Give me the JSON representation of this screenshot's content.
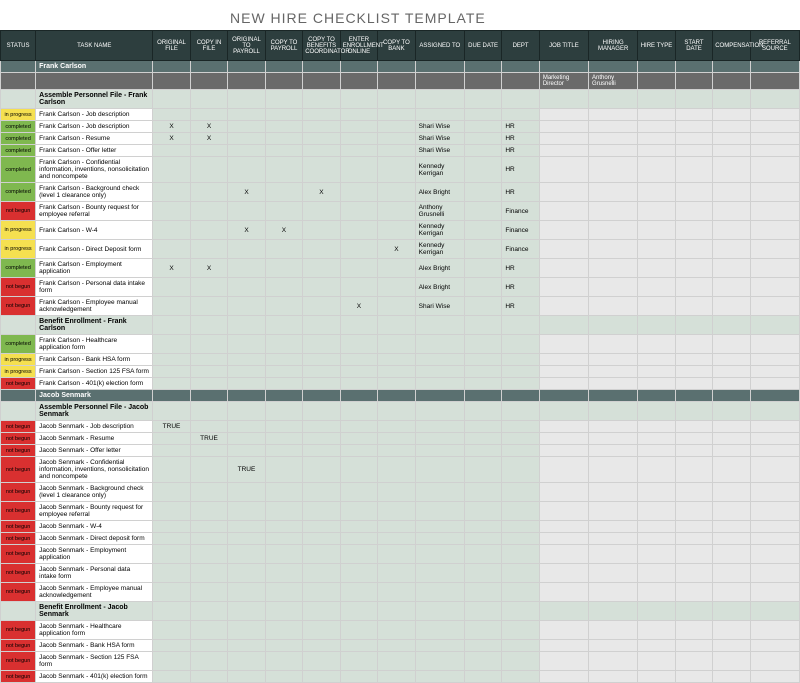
{
  "title": "NEW HIRE CHECKLIST TEMPLATE",
  "headers": [
    "STATUS",
    "TASK NAME",
    "ORIGINAL FILE",
    "COPY IN FILE",
    "ORIGINAL TO PAYROLL",
    "COPY TO PAYROLL",
    "COPY TO BENEFITS COORDINATOR",
    "ENTER ENROLLMENT ONLINE",
    "COPY TO BANK",
    "ASSIGNED TO",
    "DUE DATE",
    "DEPT",
    "JOB TITLE",
    "HIRING MANAGER",
    "HIRE TYPE",
    "START DATE",
    "COMPENSATION",
    "REFERRAL SOURCE"
  ],
  "statusLabels": {
    "completed": "completed",
    "progress": "in progress",
    "notbegun": "not begun"
  },
  "jobTitle": "Marketing Director",
  "hiringMgr": "Anthony Grusnelli",
  "employees": [
    {
      "name": "Frank Carlson",
      "sections": [
        {
          "title": "Assemble Personnel File - Frank Carlson",
          "rows": [
            {
              "status": "progress",
              "task": "Frank Carlson - Job description",
              "marks": [
                null,
                null,
                null,
                null,
                null,
                null,
                null
              ],
              "assigned": "",
              "dept": ""
            },
            {
              "status": "completed",
              "task": "Frank Carlson - Job description",
              "marks": [
                "X",
                "X",
                null,
                null,
                null,
                null,
                null
              ],
              "assigned": "Shari Wise",
              "dept": "HR"
            },
            {
              "status": "completed",
              "task": "Frank Carlson - Resume",
              "marks": [
                "X",
                "X",
                null,
                null,
                null,
                null,
                null
              ],
              "assigned": "Shari Wise",
              "dept": "HR"
            },
            {
              "status": "completed",
              "task": "Frank Carlson - Offer letter",
              "marks": [
                null,
                null,
                null,
                null,
                null,
                null,
                null
              ],
              "assigned": "Shari Wise",
              "dept": "HR"
            },
            {
              "status": "completed",
              "task": "Frank Carlson - Confidential information, inventions, nonsolicitation and noncompete",
              "marks": [
                null,
                null,
                null,
                null,
                null,
                null,
                null
              ],
              "assigned": "Kennedy Kerrigan",
              "dept": "HR"
            },
            {
              "status": "completed",
              "task": "Frank Carlson - Background check (level 1 clearance only)",
              "marks": [
                null,
                null,
                "X",
                null,
                "X",
                null,
                null
              ],
              "assigned": "Alex Bright",
              "dept": "HR"
            },
            {
              "status": "notbegun",
              "task": "Frank Carlson - Bounty request for employee referral",
              "marks": [
                null,
                null,
                null,
                null,
                null,
                null,
                null
              ],
              "assigned": "Anthony Grusnelli",
              "dept": "Finance"
            },
            {
              "status": "progress",
              "task": "Frank Carlson - W-4",
              "marks": [
                null,
                null,
                "X",
                "X",
                null,
                null,
                null
              ],
              "assigned": "Kennedy Kerrigan",
              "dept": "Finance"
            },
            {
              "status": "progress",
              "task": "Frank Carlson - Direct Deposit form",
              "marks": [
                null,
                null,
                null,
                null,
                null,
                null,
                "X"
              ],
              "assigned": "Kennedy Kerrigan",
              "dept": "Finance"
            },
            {
              "status": "completed",
              "task": "Frank Carlson - Employment application",
              "marks": [
                "X",
                "X",
                null,
                null,
                null,
                null,
                null
              ],
              "assigned": "Alex Bright",
              "dept": "HR"
            },
            {
              "status": "notbegun",
              "task": "Frank Carlson - Personal data intake form",
              "marks": [
                null,
                null,
                null,
                null,
                null,
                null,
                null
              ],
              "assigned": "Alex Bright",
              "dept": "HR"
            },
            {
              "status": "notbegun",
              "task": "Frank Carlson - Employee manual acknowledgement",
              "marks": [
                null,
                null,
                null,
                null,
                null,
                "X",
                null
              ],
              "assigned": "Shari Wise",
              "dept": "HR"
            }
          ]
        },
        {
          "title": "Benefit Enrollment - Frank Carlson",
          "rows": [
            {
              "status": "completed",
              "task": "Frank Carlson - Healthcare application form",
              "marks": [
                null,
                null,
                null,
                null,
                null,
                null,
                null
              ],
              "assigned": "",
              "dept": ""
            },
            {
              "status": "progress",
              "task": "Frank Carlson - Bank HSA form",
              "marks": [
                null,
                null,
                null,
                null,
                null,
                null,
                null
              ],
              "assigned": "",
              "dept": ""
            },
            {
              "status": "progress",
              "task": "Frank Carlson - Section 125 FSA form",
              "marks": [
                null,
                null,
                null,
                null,
                null,
                null,
                null
              ],
              "assigned": "",
              "dept": ""
            },
            {
              "status": "notbegun",
              "task": "Frank Carlson - 401(k) election form",
              "marks": [
                null,
                null,
                null,
                null,
                null,
                null,
                null
              ],
              "assigned": "",
              "dept": ""
            }
          ]
        }
      ]
    },
    {
      "name": "Jacob Senmark",
      "sections": [
        {
          "title": "Assemble Personnel File - Jacob Senmark",
          "rows": [
            {
              "status": "notbegun",
              "task": "Jacob Senmark - Job description",
              "marks": [
                "TRUE",
                null,
                null,
                null,
                null,
                null,
                null
              ],
              "assigned": "",
              "dept": ""
            },
            {
              "status": "notbegun",
              "task": "Jacob Senmark - Resume",
              "marks": [
                null,
                "TRUE",
                null,
                null,
                null,
                null,
                null
              ],
              "assigned": "",
              "dept": ""
            },
            {
              "status": "notbegun",
              "task": "Jacob Senmark - Offer letter",
              "marks": [
                null,
                null,
                null,
                null,
                null,
                null,
                null
              ],
              "assigned": "",
              "dept": ""
            },
            {
              "status": "notbegun",
              "task": "Jacob Senmark - Confidential information, inventions, nonsolicitation and noncompete",
              "marks": [
                null,
                null,
                "TRUE",
                null,
                null,
                null,
                null
              ],
              "assigned": "",
              "dept": ""
            },
            {
              "status": "notbegun",
              "task": "Jacob Senmark - Background check (level 1 clearance only)",
              "marks": [
                null,
                null,
                null,
                null,
                null,
                null,
                null
              ],
              "assigned": "",
              "dept": ""
            },
            {
              "status": "notbegun",
              "task": "Jacob Senmark - Bounty request for employee referral",
              "marks": [
                null,
                null,
                null,
                null,
                null,
                null,
                null
              ],
              "assigned": "",
              "dept": ""
            },
            {
              "status": "notbegun",
              "task": "Jacob Senmark - W-4",
              "marks": [
                null,
                null,
                null,
                null,
                null,
                null,
                null
              ],
              "assigned": "",
              "dept": ""
            },
            {
              "status": "notbegun",
              "task": "Jacob Senmark - Direct deposit form",
              "marks": [
                null,
                null,
                null,
                null,
                null,
                null,
                null
              ],
              "assigned": "",
              "dept": ""
            },
            {
              "status": "notbegun",
              "task": "Jacob Senmark - Employment application",
              "marks": [
                null,
                null,
                null,
                null,
                null,
                null,
                null
              ],
              "assigned": "",
              "dept": ""
            },
            {
              "status": "notbegun",
              "task": "Jacob Senmark - Personal data intake form",
              "marks": [
                null,
                null,
                null,
                null,
                null,
                null,
                null
              ],
              "assigned": "",
              "dept": ""
            },
            {
              "status": "notbegun",
              "task": "Jacob Senmark - Employee manual acknowledgement",
              "marks": [
                null,
                null,
                null,
                null,
                null,
                null,
                null
              ],
              "assigned": "",
              "dept": ""
            }
          ]
        },
        {
          "title": "Benefit Enrollment - Jacob Senmark",
          "rows": [
            {
              "status": "notbegun",
              "task": "Jacob Senmark - Healthcare application form",
              "marks": [
                null,
                null,
                null,
                null,
                null,
                null,
                null
              ],
              "assigned": "",
              "dept": ""
            },
            {
              "status": "notbegun",
              "task": "Jacob Senmark - Bank HSA form",
              "marks": [
                null,
                null,
                null,
                null,
                null,
                null,
                null
              ],
              "assigned": "",
              "dept": ""
            },
            {
              "status": "notbegun",
              "task": "Jacob Senmark - Section 125 FSA form",
              "marks": [
                null,
                null,
                null,
                null,
                null,
                null,
                null
              ],
              "assigned": "",
              "dept": ""
            },
            {
              "status": "notbegun",
              "task": "Jacob Senmark - 401(k) election form",
              "marks": [
                null,
                null,
                null,
                null,
                null,
                null,
                null
              ],
              "assigned": "",
              "dept": ""
            }
          ]
        }
      ]
    }
  ]
}
